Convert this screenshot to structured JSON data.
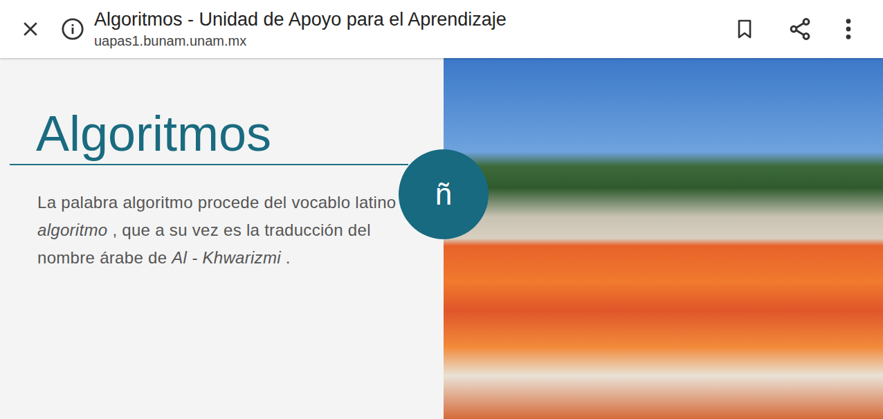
{
  "browser": {
    "title": "Algoritmos - Unidad de Apoyo para el Aprendizaje",
    "url": "uapas1.bunam.unam.mx"
  },
  "page": {
    "heading": "Algoritmos",
    "paragraph": [
      {
        "text": "La palabra algoritmo procede del vocablo latino ",
        "italic": false
      },
      {
        "text": "algoritmo",
        "italic": true
      },
      {
        "text": " , que a su vez es la traducción del nombre árabe de ",
        "italic": false
      },
      {
        "text": "Al - Khwarizmi",
        "italic": true
      },
      {
        "text": " .",
        "italic": false
      }
    ],
    "badge": "ñ"
  }
}
